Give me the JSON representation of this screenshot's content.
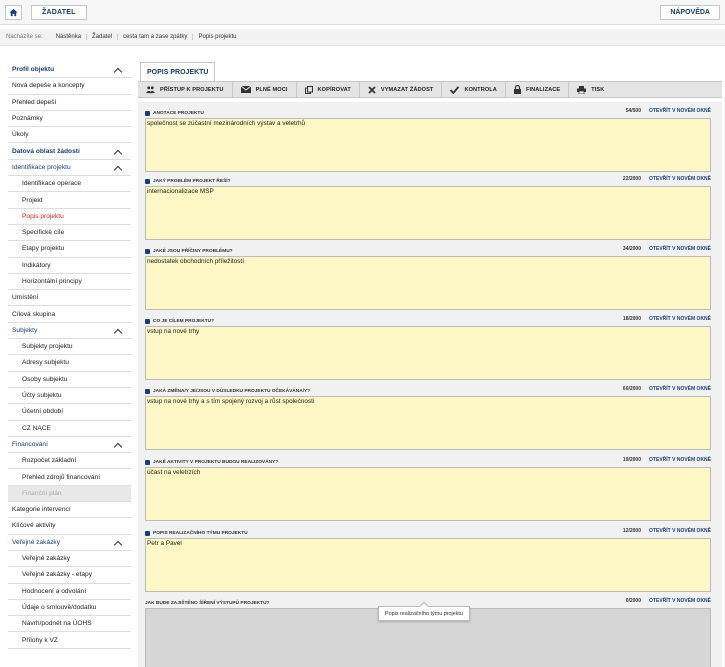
{
  "header": {
    "zadatel_label": "ŽADATEL",
    "napoveda_label": "NÁPOVĚDA"
  },
  "breadcrumb": {
    "label": "Nacházíte se:",
    "items": [
      "Nástěnka",
      "Žadatel",
      "cesta tam a zase zpátky",
      "Popis projektu"
    ]
  },
  "sidebar": {
    "items": [
      {
        "label": "Profil objektu"
      },
      {
        "label": "Nová depeše a koncepty"
      },
      {
        "label": "Přehled depeší"
      },
      {
        "label": "Poznámky"
      },
      {
        "label": "Úkoly"
      },
      {
        "label": "Datová oblast žádosti"
      },
      {
        "label": "Identifikace projektu"
      },
      {
        "label": "Identifikace operace"
      },
      {
        "label": "Projekt"
      },
      {
        "label": "Popis projektu"
      },
      {
        "label": "Specifické cíle"
      },
      {
        "label": "Etapy projektu"
      },
      {
        "label": "Indikátory"
      },
      {
        "label": "Horizontální principy"
      },
      {
        "label": "Umístění"
      },
      {
        "label": "Cílová skupina"
      },
      {
        "label": "Subjekty"
      },
      {
        "label": "Subjekty projektu"
      },
      {
        "label": "Adresy subjektu"
      },
      {
        "label": "Osoby subjektu"
      },
      {
        "label": "Účty subjektu"
      },
      {
        "label": "Účetní období"
      },
      {
        "label": "CZ NACE"
      },
      {
        "label": "Financování"
      },
      {
        "label": "Rozpočet základní"
      },
      {
        "label": "Přehled zdrojů financování"
      },
      {
        "label": "Finanční plán"
      },
      {
        "label": "Kategorie intervencí"
      },
      {
        "label": "Klíčové aktivity"
      },
      {
        "label": "Veřejné zakázky"
      },
      {
        "label": "Veřejné zakázky"
      },
      {
        "label": "Veřejné zakázky - etapy"
      },
      {
        "label": "Hodnocení a odvolání"
      },
      {
        "label": "Údaje o smlouvě/dodatku"
      },
      {
        "label": "Návrh/podnět na ÚOHS"
      },
      {
        "label": "Přílohy k VZ"
      }
    ]
  },
  "tab": {
    "label": "POPIS PROJEKTU"
  },
  "toolbar": {
    "items": [
      {
        "label": "PŘÍSTUP K PROJEKTU",
        "icon": "people-icon"
      },
      {
        "label": "PLNÉ MOCI",
        "icon": "envelope-icon"
      },
      {
        "label": "KOPÍROVAT",
        "icon": "copy-icon"
      },
      {
        "label": "VYMAZAT ŽÁDOST",
        "icon": "x-icon"
      },
      {
        "label": "KONTROLA",
        "icon": "check-icon"
      },
      {
        "label": "FINALIZACE",
        "icon": "lock-icon"
      },
      {
        "label": "TISK",
        "icon": "printer-icon"
      }
    ]
  },
  "fields": [
    {
      "label": "ANOTACE PROJEKTU",
      "count": "54/500",
      "link": "Otevřít v novém okně",
      "value": "společnost se zúčastní mezinárodních výstav a veletrhů"
    },
    {
      "label": "JAKÝ PROBLÉM PROJEKT ŘEŠÍ?",
      "count": "22/2000",
      "link": "Otevřít v novém okně",
      "value": "internacionalizace MSP"
    },
    {
      "label": "JAKÉ JSOU PŘÍČINY PROBLÉMU?",
      "count": "34/2000",
      "link": "Otevřít v novém okně",
      "value": "nedostatek obchodních příležitostí"
    },
    {
      "label": "CO JE CÍLEM PROJEKTU?",
      "count": "18/2000",
      "link": "Otevřít v novém okně",
      "value": "vstup na nové trhy"
    },
    {
      "label": "JAKÁ ZMĚNA/Y JE/JSOU V DŮSLEDKU PROJEKTU OČEKÁVÁNA/Y?",
      "count": "60/2000",
      "link": "Otevřít v novém okně",
      "value": "vstup na nové trhy a s tím spojený rozvoj a růst společnosti"
    },
    {
      "label": "JAKÉ AKTIVITY V PROJEKTU BUDOU REALIZOVÁNY?",
      "count": "19/2000",
      "link": "Otevřít v novém okně",
      "value": "účast na veletrzích"
    },
    {
      "label": "POPIS REALIZAČNÍHO TÝMU PROJEKTU",
      "count": "12/2000",
      "link": "Otevřít v novém okně",
      "value": "Petr a Pavel"
    },
    {
      "label": "JAK BUDE ZAJIŠTĚNO ŠÍŘENÍ VÝSTUPŮ PROJEKTU?",
      "count": "0/2000",
      "link": "Otevřít v novém okně",
      "value": ""
    }
  ],
  "tooltip": {
    "text": "Popis realizačního týmu projektu"
  }
}
